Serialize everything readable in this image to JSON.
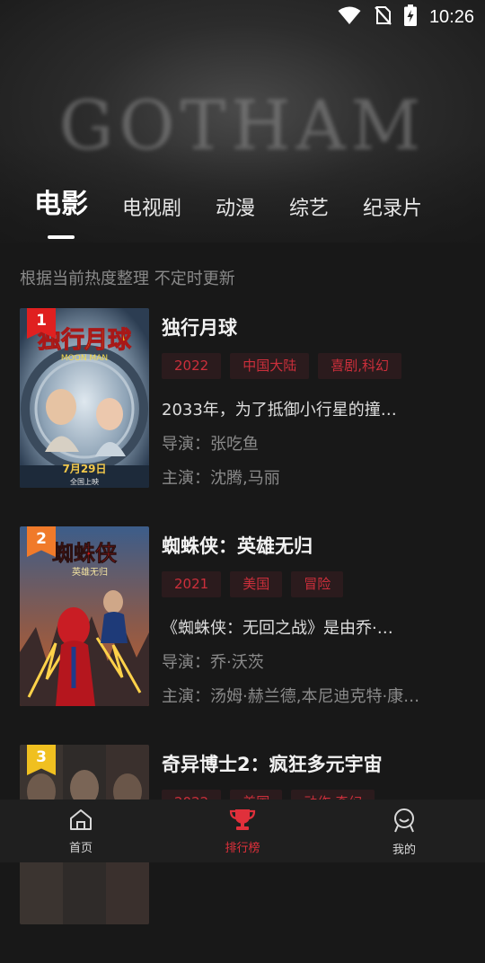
{
  "status_bar": {
    "time": "10:26"
  },
  "header": {
    "banner_text": "GOTHAM"
  },
  "tabs": [
    {
      "label": "电影",
      "active": true
    },
    {
      "label": "电视剧",
      "active": false
    },
    {
      "label": "动漫",
      "active": false
    },
    {
      "label": "综艺",
      "active": false
    },
    {
      "label": "纪录片",
      "active": false
    }
  ],
  "subtitle": "根据当前热度整理 不定时更新",
  "items": [
    {
      "rank": "1",
      "rank_color": "#e02020",
      "title": "独行月球",
      "tags": [
        "2022",
        "中国大陆",
        "喜剧,科幻"
      ],
      "description": "2033年，为了抵御小行星的撞…",
      "director": "导演：张吃鱼",
      "cast": "主演：沈腾,马丽",
      "poster": {
        "title_text": "独行月球",
        "subtitle_text": "MOON MAN",
        "date_text": "7月29日",
        "bottom_text": "全国上映"
      }
    },
    {
      "rank": "2",
      "rank_color": "#f07a2a",
      "title": "蜘蛛侠：英雄无归",
      "tags": [
        "2021",
        "美国",
        "冒险"
      ],
      "description": "《蜘蛛侠：无回之战》是由乔·…",
      "director": "导演：乔·沃茨",
      "cast": "主演：汤姆·赫兰德,本尼迪克特·康…",
      "poster": {
        "title_text": "蜘蛛侠",
        "subtitle_text": "英雄无归"
      }
    },
    {
      "rank": "3",
      "rank_color": "#f0c020",
      "title": "奇异博士2：疯狂多元宇宙",
      "tags": [
        "2022",
        "美国",
        "动作,奇幻"
      ],
      "description": "",
      "director": "",
      "cast": "",
      "poster": {}
    }
  ],
  "bottom_nav": [
    {
      "label": "首页",
      "icon": "home-icon",
      "active": false
    },
    {
      "label": "排行榜",
      "icon": "trophy-icon",
      "active": true
    },
    {
      "label": "我的",
      "icon": "profile-icon",
      "active": false
    }
  ],
  "colors": {
    "accent": "#e0303b",
    "tag_bg": "#2b1b1d",
    "background": "#181818"
  }
}
